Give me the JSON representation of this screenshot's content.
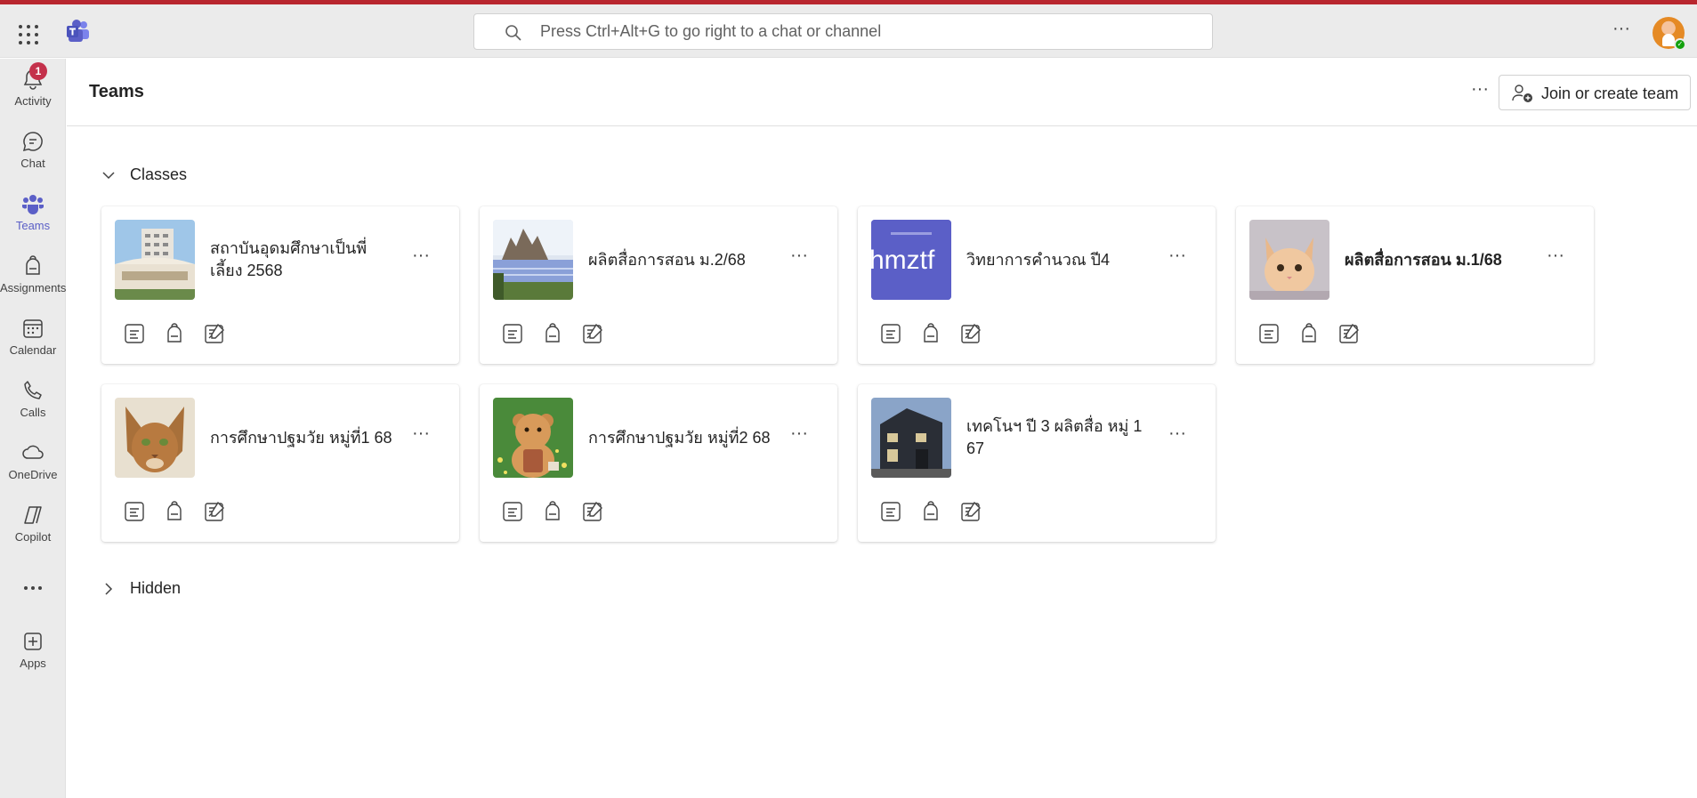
{
  "app": {
    "search_placeholder": "Press Ctrl+Alt+G to go right to a chat or channel",
    "accent": "#5b5fc7",
    "top_strip_color": "#b8262e"
  },
  "rail": {
    "items": [
      {
        "label": "Activity",
        "icon": "bell-icon",
        "badge": "1"
      },
      {
        "label": "Chat",
        "icon": "chat-icon"
      },
      {
        "label": "Teams",
        "icon": "teams-icon",
        "active": true
      },
      {
        "label": "Assignments",
        "icon": "backpack-icon"
      },
      {
        "label": "Calendar",
        "icon": "calendar-icon"
      },
      {
        "label": "Calls",
        "icon": "phone-icon"
      },
      {
        "label": "OneDrive",
        "icon": "cloud-icon"
      },
      {
        "label": "Copilot",
        "icon": "copilot-icon"
      },
      {
        "label": "",
        "icon": "more-icon"
      },
      {
        "label": "Apps",
        "icon": "add-apps-icon"
      }
    ]
  },
  "header": {
    "title": "Teams",
    "join_label": "Join or create team"
  },
  "sections": {
    "classes": {
      "label": "Classes",
      "expanded": true
    },
    "hidden": {
      "label": "Hidden",
      "expanded": false
    }
  },
  "cards": [
    {
      "name": "สถาบันอุดมศึกษาเป็นพี่เลี้ยง 2568",
      "thumbnail": "building-photo"
    },
    {
      "name": "ผลิตสื่อการสอน ม.2/68",
      "thumbnail": "river-temple-photo"
    },
    {
      "name": "วิทยาการคำนวณ ปี4",
      "thumbnail": "purple-tile",
      "thumbnail_text": "hmztf",
      "thumbnail_color": "#5b5fc7"
    },
    {
      "name": "ผลิตสื่อการสอน ม.1/68",
      "thumbnail": "cat-photo",
      "bold": true
    },
    {
      "name": "การศึกษาปฐมวัย หมู่ที่1 68",
      "thumbnail": "abyssinian-cat-photo"
    },
    {
      "name": "การศึกษาปฐมวัย หมู่ที่2 68",
      "thumbnail": "teddy-bear-photo"
    },
    {
      "name": "เทคโนฯ ปี 3 ผลิตสื่อ หมู่ 1 67",
      "thumbnail": "house-photo"
    }
  ],
  "card_actions": [
    "posts-icon",
    "assignments-icon",
    "grades-icon"
  ]
}
